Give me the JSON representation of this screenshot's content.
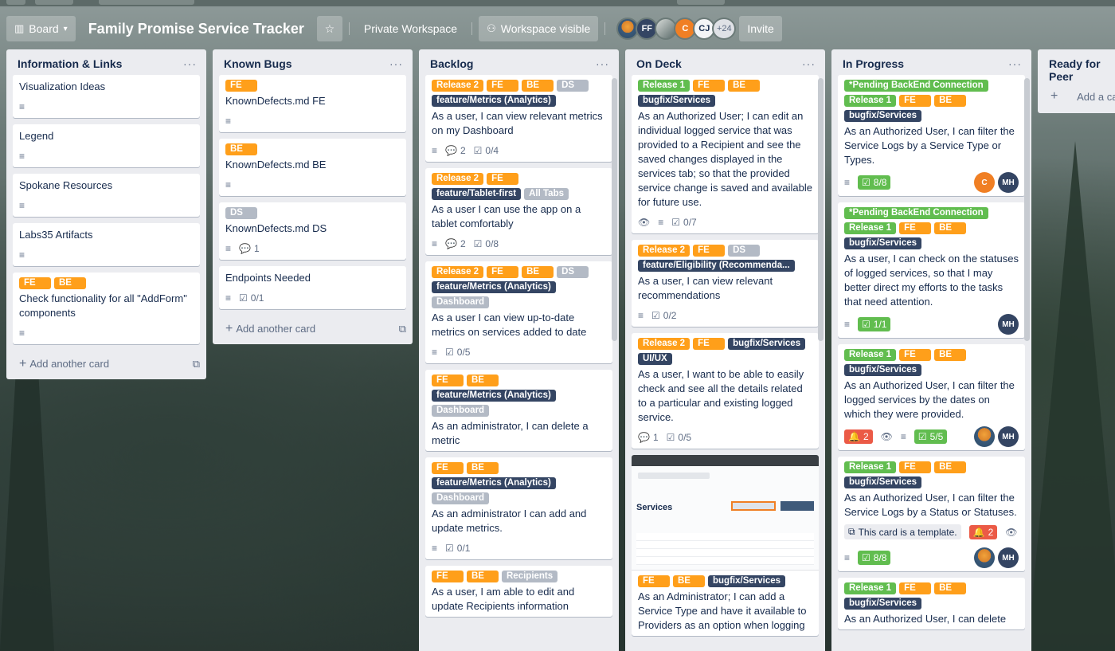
{
  "header": {
    "board_view": "Board",
    "board_title": "Family Promise Service Tracker",
    "workspace": "Private Workspace",
    "visibility": "Workspace visible",
    "members": [
      {
        "initials": "",
        "kind": "photo"
      },
      {
        "initials": "FF",
        "kind": "ff"
      },
      {
        "initials": "",
        "kind": "cam"
      },
      {
        "initials": "C",
        "kind": "c"
      },
      {
        "initials": "CJ",
        "kind": "cj"
      }
    ],
    "more_members": "+24",
    "invite": "Invite"
  },
  "colors": {
    "orange": "#ff9f1a",
    "sage": "#61bd4f",
    "navy": "#344563",
    "grey": "#b3bac5"
  },
  "add_another_card": "Add another card",
  "add_a_card": "Add a card",
  "lists": [
    {
      "title": "Information & Links",
      "cards": [
        {
          "labels": [],
          "title": "Visualization Ideas",
          "badges": [
            {
              "icon": "≡",
              "text": ""
            }
          ]
        },
        {
          "labels": [],
          "title": "Legend",
          "badges": [
            {
              "icon": "≡",
              "text": ""
            }
          ]
        },
        {
          "labels": [],
          "title": "Spokane Resources",
          "badges": [
            {
              "icon": "≡",
              "text": ""
            }
          ]
        },
        {
          "labels": [],
          "title": "Labs35 Artifacts",
          "badges": [
            {
              "icon": "≡",
              "text": ""
            }
          ]
        },
        {
          "labels": [
            {
              "text": "FE",
              "color": "orange"
            },
            {
              "text": "BE",
              "color": "orange"
            }
          ],
          "title": "Check functionality for all \"AddForm\" components",
          "badges": [
            {
              "icon": "≡",
              "text": ""
            }
          ]
        }
      ]
    },
    {
      "title": "Known Bugs",
      "cards": [
        {
          "labels": [
            {
              "text": "FE",
              "color": "orange"
            }
          ],
          "title": "KnownDefects.md FE",
          "badges": [
            {
              "icon": "≡",
              "text": ""
            }
          ]
        },
        {
          "labels": [
            {
              "text": "BE",
              "color": "orange"
            }
          ],
          "title": "KnownDefects.md BE",
          "badges": [
            {
              "icon": "≡",
              "text": ""
            }
          ]
        },
        {
          "labels": [
            {
              "text": "DS",
              "color": "grey"
            }
          ],
          "title": "KnownDefects.md DS",
          "badges": [
            {
              "icon": "≡",
              "text": ""
            },
            {
              "icon": "💬",
              "text": "1"
            }
          ]
        },
        {
          "labels": [],
          "title": "Endpoints Needed",
          "badges": [
            {
              "icon": "≡",
              "text": ""
            },
            {
              "icon": "☑",
              "text": "0/1"
            }
          ]
        }
      ]
    },
    {
      "title": "Backlog",
      "cards": [
        {
          "labels": [
            {
              "text": "Release 2",
              "color": "orange"
            },
            {
              "text": "FE",
              "color": "orange"
            },
            {
              "text": "BE",
              "color": "orange"
            },
            {
              "text": "DS",
              "color": "grey"
            },
            {
              "text": "feature/Metrics (Analytics)",
              "color": "navy"
            }
          ],
          "title": "As a user, I can view relevant metrics on my Dashboard",
          "badges": [
            {
              "icon": "≡",
              "text": ""
            },
            {
              "icon": "💬",
              "text": "2"
            },
            {
              "icon": "☑",
              "text": "0/4"
            }
          ]
        },
        {
          "labels": [
            {
              "text": "Release 2",
              "color": "orange"
            },
            {
              "text": "FE",
              "color": "orange"
            },
            {
              "text": "feature/Tablet-first",
              "color": "navy"
            },
            {
              "text": "All Tabs",
              "color": "grey"
            }
          ],
          "title": "As a user I can use the app on a tablet comfortably",
          "badges": [
            {
              "icon": "≡",
              "text": ""
            },
            {
              "icon": "💬",
              "text": "2"
            },
            {
              "icon": "☑",
              "text": "0/8"
            }
          ]
        },
        {
          "labels": [
            {
              "text": "Release 2",
              "color": "orange"
            },
            {
              "text": "FE",
              "color": "orange"
            },
            {
              "text": "BE",
              "color": "orange"
            },
            {
              "text": "DS",
              "color": "grey"
            },
            {
              "text": "feature/Metrics (Analytics)",
              "color": "navy"
            },
            {
              "text": "Dashboard",
              "color": "grey"
            }
          ],
          "title": "As a user I can view up-to-date metrics on services added to date",
          "badges": [
            {
              "icon": "≡",
              "text": ""
            },
            {
              "icon": "☑",
              "text": "0/5"
            }
          ]
        },
        {
          "labels": [
            {
              "text": "FE",
              "color": "orange"
            },
            {
              "text": "BE",
              "color": "orange"
            },
            {
              "text": "feature/Metrics (Analytics)",
              "color": "navy"
            },
            {
              "text": "Dashboard",
              "color": "grey"
            }
          ],
          "title": "As an administrator, I can delete a metric",
          "badges": []
        },
        {
          "labels": [
            {
              "text": "FE",
              "color": "orange"
            },
            {
              "text": "BE",
              "color": "orange"
            },
            {
              "text": "feature/Metrics (Analytics)",
              "color": "navy"
            },
            {
              "text": "Dashboard",
              "color": "grey"
            }
          ],
          "title": "As an administrator I can add and update metrics.",
          "badges": [
            {
              "icon": "≡",
              "text": ""
            },
            {
              "icon": "☑",
              "text": "0/1"
            }
          ]
        },
        {
          "labels": [
            {
              "text": "FE",
              "color": "orange"
            },
            {
              "text": "BE",
              "color": "orange"
            },
            {
              "text": "Recipients",
              "color": "grey"
            }
          ],
          "title": "As a user, I am able to edit and update Recipients information",
          "badges": []
        }
      ]
    },
    {
      "title": "On Deck",
      "cards": [
        {
          "labels": [
            {
              "text": "Release 1",
              "color": "sage"
            },
            {
              "text": "FE",
              "color": "orange"
            },
            {
              "text": "BE",
              "color": "orange"
            },
            {
              "text": "bugfix/Services",
              "color": "navy"
            }
          ],
          "title": "As an Authorized User; I can edit an individual logged service that was provided to a Recipient and see the saved changes displayed in the services tab; so that the provided service change is saved and available for future use.",
          "badges": [
            {
              "icon": "👁",
              "text": ""
            },
            {
              "icon": "≡",
              "text": ""
            },
            {
              "icon": "☑",
              "text": "0/7"
            }
          ]
        },
        {
          "labels": [
            {
              "text": "Release 2",
              "color": "orange"
            },
            {
              "text": "FE",
              "color": "orange"
            },
            {
              "text": "DS",
              "color": "grey"
            },
            {
              "text": "feature/Eligibility (Recommenda...",
              "color": "navy"
            }
          ],
          "title": "As a user, I can view relevant recommendations",
          "badges": [
            {
              "icon": "≡",
              "text": ""
            },
            {
              "icon": "☑",
              "text": "0/2"
            }
          ]
        },
        {
          "labels": [
            {
              "text": "Release 2",
              "color": "orange"
            },
            {
              "text": "FE",
              "color": "orange"
            },
            {
              "text": "bugfix/Services",
              "color": "navy"
            },
            {
              "text": "UI/UX",
              "color": "navy"
            }
          ],
          "title": "As a user, I want to be able to easily check and see all the details related to a particular and existing logged service.",
          "badges": [
            {
              "icon": "💬",
              "text": "1"
            },
            {
              "icon": "☑",
              "text": "0/5"
            }
          ]
        },
        {
          "cover": true,
          "cover_heading": "Services",
          "labels": [
            {
              "text": "FE",
              "color": "orange"
            },
            {
              "text": "BE",
              "color": "orange"
            },
            {
              "text": "bugfix/Services",
              "color": "navy"
            }
          ],
          "title": "As an Administrator; I can add a Service Type and have it available to Providers as an option when logging",
          "badges": []
        }
      ]
    },
    {
      "title": "In Progress",
      "cards": [
        {
          "labels": [
            {
              "text": "*Pending BackEnd Connection",
              "color": "sage"
            },
            {
              "text": "Release 1",
              "color": "sage"
            },
            {
              "text": "FE",
              "color": "orange"
            },
            {
              "text": "BE",
              "color": "orange"
            },
            {
              "text": "bugfix/Services",
              "color": "navy"
            }
          ],
          "title": "As an Authorized User, I can filter the Service Logs by a Service Type or Types.",
          "badges": [
            {
              "icon": "≡",
              "text": ""
            },
            {
              "icon": "☑",
              "text": "8/8",
              "style": "green"
            }
          ],
          "members": [
            "C",
            "MH"
          ]
        },
        {
          "labels": [
            {
              "text": "*Pending BackEnd Connection",
              "color": "sage"
            },
            {
              "text": "Release 1",
              "color": "sage"
            },
            {
              "text": "FE",
              "color": "orange"
            },
            {
              "text": "BE",
              "color": "orange"
            },
            {
              "text": "bugfix/Services",
              "color": "navy"
            }
          ],
          "title": "As a user, I can check on the statuses of logged services, so that I may better direct my efforts to the tasks that need attention.",
          "badges": [
            {
              "icon": "≡",
              "text": ""
            },
            {
              "icon": "☑",
              "text": "1/1",
              "style": "green"
            }
          ],
          "members": [
            "MH"
          ]
        },
        {
          "labels": [
            {
              "text": "Release 1",
              "color": "sage"
            },
            {
              "text": "FE",
              "color": "orange"
            },
            {
              "text": "BE",
              "color": "orange"
            },
            {
              "text": "bugfix/Services",
              "color": "navy"
            }
          ],
          "title": "As an Authorized User, I can filter the logged services by the dates on which they were provided.",
          "badges": [
            {
              "icon": "🔔",
              "text": "2",
              "style": "red"
            },
            {
              "icon": "👁",
              "text": ""
            },
            {
              "icon": "≡",
              "text": ""
            },
            {
              "icon": "☑",
              "text": "5/5",
              "style": "green"
            }
          ],
          "members": [
            "photo",
            "MH"
          ]
        },
        {
          "labels": [
            {
              "text": "Release 1",
              "color": "sage"
            },
            {
              "text": "FE",
              "color": "orange"
            },
            {
              "text": "BE",
              "color": "orange"
            },
            {
              "text": "bugfix/Services",
              "color": "navy"
            }
          ],
          "title": "As an Authorized User, I can filter the Service Logs by a Status or Statuses.",
          "badges": [
            {
              "icon": "⧉",
              "text": "This card is a template.",
              "style": "grey"
            },
            {
              "icon": "🔔",
              "text": "2",
              "style": "red"
            },
            {
              "icon": "👁",
              "text": ""
            },
            {
              "icon": "≡",
              "text": ""
            },
            {
              "icon": "☑",
              "text": "8/8",
              "style": "green"
            }
          ],
          "members": [
            "photo",
            "MH"
          ]
        },
        {
          "labels": [
            {
              "text": "Release 1",
              "color": "sage"
            },
            {
              "text": "FE",
              "color": "orange"
            },
            {
              "text": "BE",
              "color": "orange"
            },
            {
              "text": "bugfix/Services",
              "color": "navy"
            }
          ],
          "title": "As an Authorized User, I can delete",
          "badges": []
        }
      ]
    },
    {
      "title": "Ready for Peer",
      "cards": []
    }
  ]
}
